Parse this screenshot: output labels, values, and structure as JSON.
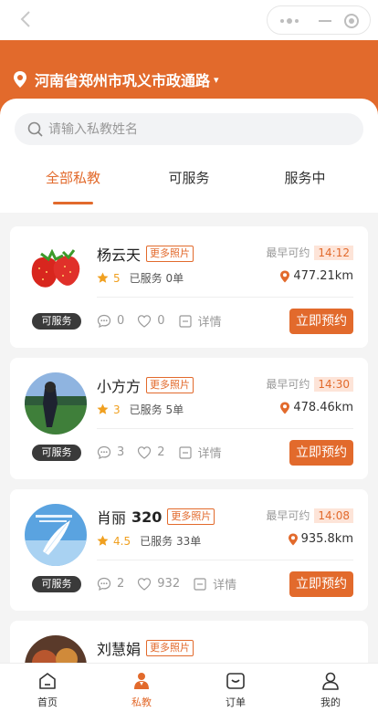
{
  "location": {
    "text": "河南省郑州市巩义市政通路",
    "caret": "▾"
  },
  "search": {
    "placeholder": "请输入私教姓名",
    "value": ""
  },
  "tabs": [
    {
      "label": "全部私教",
      "active": true
    },
    {
      "label": "可服务",
      "active": false
    },
    {
      "label": "服务中",
      "active": false
    }
  ],
  "labels": {
    "more_photos": "更多照片",
    "earliest": "最早可约",
    "served_prefix": "已服务",
    "served_suffix": "单",
    "details": "详情",
    "book": "立即预约"
  },
  "coaches": [
    {
      "name": "杨云天",
      "name_suffix": "",
      "time": "14:12",
      "score": "5",
      "served": "0",
      "distance": "477.21km",
      "comments": "0",
      "likes": "0",
      "status": "可服务",
      "avatar": "strawberry"
    },
    {
      "name": "小方方",
      "name_suffix": "",
      "time": "14:30",
      "score": "3",
      "served": "5",
      "distance": "478.46km",
      "comments": "3",
      "likes": "2",
      "status": "可服务",
      "avatar": "person-field"
    },
    {
      "name": "肖丽",
      "name_suffix": "320",
      "time": "14:08",
      "score": "4.5",
      "served": "33",
      "distance": "935.8km",
      "comments": "2",
      "likes": "932",
      "status": "可服务",
      "avatar": "feather-sky"
    },
    {
      "name": "刘慧娟",
      "name_suffix": "",
      "time": "",
      "score": "",
      "served": "",
      "distance": "",
      "comments": "",
      "likes": "",
      "status": "",
      "avatar": "food"
    }
  ],
  "nav": [
    {
      "label": "首页",
      "icon": "home-icon",
      "active": false
    },
    {
      "label": "私教",
      "icon": "coach-icon",
      "active": true
    },
    {
      "label": "订单",
      "icon": "order-icon",
      "active": false
    },
    {
      "label": "我的",
      "icon": "profile-icon",
      "active": false
    }
  ],
  "colors": {
    "accent": "#e26a2c",
    "badge": "#3a3a3a",
    "star": "#f0a020",
    "time_bg": "#fde4d8"
  }
}
